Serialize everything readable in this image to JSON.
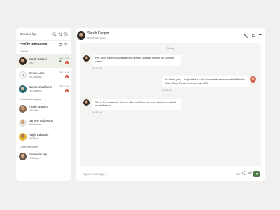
{
  "sidebar": {
    "grouped_by": "Grouped by",
    "title": "Profile messages",
    "sections": {
      "unread": "Unread",
      "favorite": "Favorite Messages",
      "direct": "Direct Messages"
    },
    "unread": [
      {
        "name": "Sarah Cooper",
        "preview": "Hel...",
        "time": "09:15 AM",
        "badge": "2"
      },
      {
        "name": "Devon Lane",
        "preview": "Hi Camero...",
        "time": "09:15 AM",
        "badge": "3",
        "initials": "M"
      },
      {
        "name": "Cameron Williams",
        "preview": "Hi Camero...",
        "time": "09:15 AM",
        "badge": "2"
      }
    ],
    "favorite": [
      {
        "name": "Kristin Watson",
        "preview": "Hi Kristin..."
      },
      {
        "name": "Darlene Robertson",
        "preview": "Hi Darlene..."
      },
      {
        "name": "Ralph Edwards",
        "preview": "Hi Ralph..."
      }
    ],
    "direct": [
      {
        "name": "Savannah Ngu...",
        "preview": "Hi Savan..."
      }
    ]
  },
  "chat": {
    "name": "Sarah Cooper",
    "subtitle": "Contract Law",
    "date_divider": "Today",
    "messages": [
      {
        "text": "Hey John, have you uploaded the revised contract draft for the Mitchell case?",
        "time": "09:15 AM"
      },
      {
        "text": "Hi Sarah, yes — I uploaded it in the Documents section under Mitchell v. Orion Corp. Please review version 2.3.",
        "time": "09:20 AM"
      },
      {
        "text": "Got it, I'll review now. Has the client confirmed the new clause we added on arbitration?",
        "time": "09:23 AM"
      }
    ],
    "composer_placeholder": "Type a message..."
  },
  "colors": {
    "accent": "#4b7a48",
    "badge": "#d9412e",
    "page_bg": "#f0f0ee",
    "chat_bg": "#f4f4f2"
  }
}
